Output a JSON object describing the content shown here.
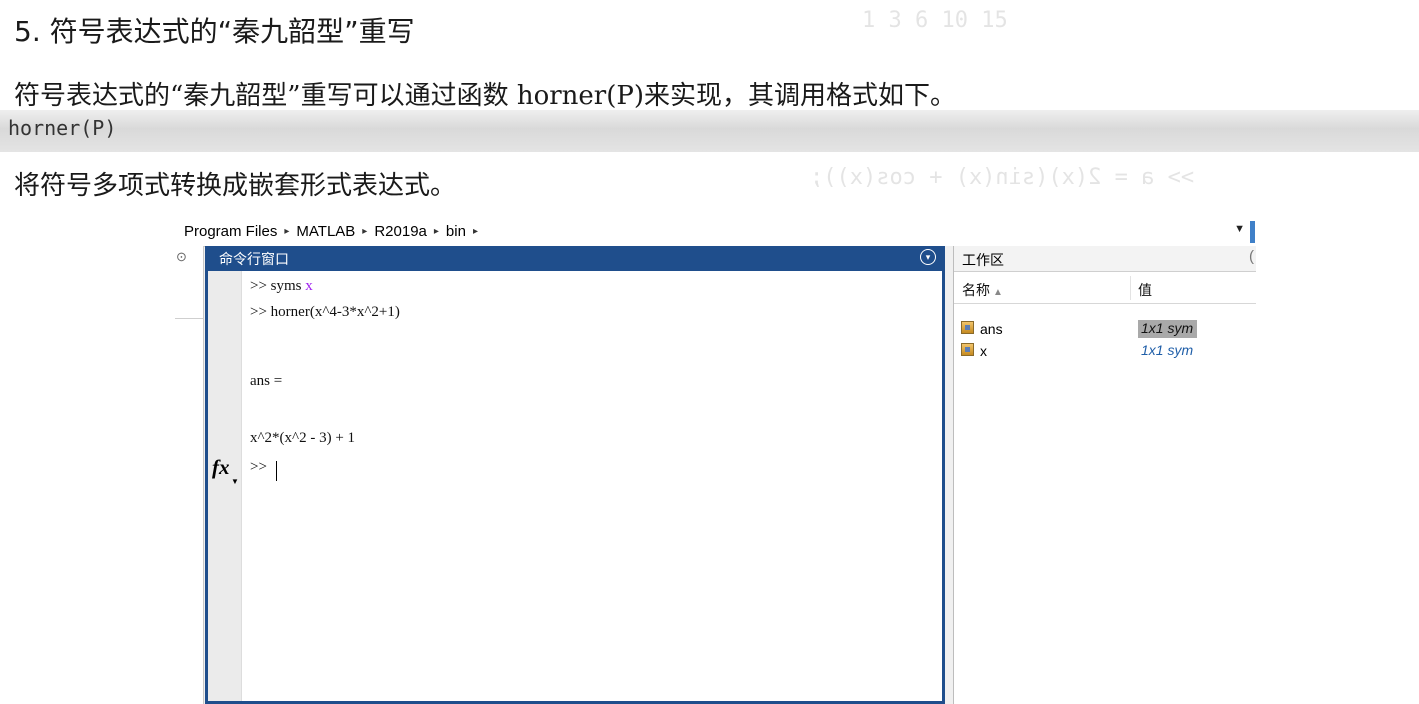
{
  "book": {
    "section_title": "5. 符号表达式的“秦九韶型”重写",
    "paragraph_1": "符号表达式的“秦九韶型”重写可以通过函数 horner(P)来实现，其调用格式如下。",
    "code_line": "horner(P)",
    "paragraph_2": "将符号多项式转换成嵌套形式表达式。",
    "bleed_through": [
      "1   3   6   10   15",
      ">> a = 2(x)(sin(x) + cos(x));"
    ]
  },
  "matlab": {
    "address_bar": {
      "crumbs": [
        "Program Files",
        "MATLAB",
        "R2019a",
        "bin"
      ],
      "separator": "▸",
      "dropdown_icon": "chevron-down-icon"
    },
    "command_window": {
      "title": "命令行窗口",
      "menu_icon": "panel-menu-icon",
      "lines": [
        {
          "prompt": ">> ",
          "text": "syms ",
          "var": "x"
        },
        {
          "prompt": ">> ",
          "text": "horner(x^4-3*x^2+1)",
          "var": ""
        },
        {
          "prompt": "",
          "text": "ans =",
          "var": ""
        },
        {
          "prompt": "",
          "text": "x^2*(x^2 - 3) + 1",
          "var": ""
        }
      ],
      "fx_label": "fx",
      "current_prompt": ">>"
    },
    "workspace": {
      "title": "工作区",
      "columns": [
        "名称",
        "值"
      ],
      "sort_indicator": "▲",
      "variables": [
        {
          "name": "ans",
          "value": "1x1 sym",
          "selected": true
        },
        {
          "name": "x",
          "value": "1x1 sym",
          "selected": false
        }
      ]
    }
  },
  "colors": {
    "title_bar": "#1f4e8c",
    "symbolic_var": "#a020f0",
    "value_text": "#1f5ea8",
    "selected_value_bg": "#a9a9a9"
  }
}
